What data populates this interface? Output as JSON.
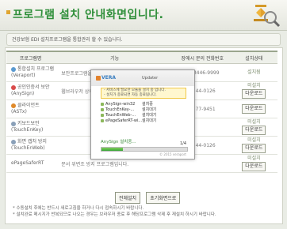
{
  "header": {
    "title": "프로그램 설치 안내화면입니다."
  },
  "notice": "건강보험 EDI 설치프로그램을 통합관리 할 수 있습니다.",
  "table": {
    "headers": [
      "프로그램명",
      "기능",
      "장애시 문의 전화번호",
      "설치상태"
    ],
    "rows": [
      {
        "name": "통합설치 프로그램 (Veraport)",
        "desc": "보안프로그램을 편리하게 다운받기 위한 프로그램입",
        "phone": "02-3446-9999",
        "status": "설치됨",
        "button": ""
      },
      {
        "name": "공인인증서 보안(AnySign)",
        "desc": "웹브라우저 상의 공인인증서",
        "phone": "1544-0126",
        "status": "미설치",
        "button": "다운로드"
      },
      {
        "name": "클라이언트(ASTx)",
        "desc": "",
        "phone": "1577-9451",
        "status": "",
        "button": "다운로드"
      },
      {
        "name": "키보드보안 (TouchEnKey)",
        "desc": "",
        "phone": "",
        "status": "미설치",
        "button": "다운로드"
      },
      {
        "name": "화면 캡처 방지 (TouchEnWeb)",
        "desc": "",
        "phone": "1544-0126",
        "status": "미설치",
        "button": "다운로드"
      },
      {
        "name": "ePageSaferRT",
        "desc": "문서 위변조 방지 프로그램입니다.",
        "phone": "",
        "status": "미설치",
        "button": "다운로드"
      }
    ]
  },
  "buttons": {
    "install_all": "전체설치",
    "back": "초기화면으로"
  },
  "footnotes": [
    "* 수동설치 후에는 반드시 새로고침을 하거나 다시 접속하시기 바랍니다.",
    "* 설치완료 메시지가 반복되므로 나오는 경우는 브라우저 종료 후 해당프로그램 삭제 후 재설치 하시기 바랍니다."
  ],
  "popup": {
    "logo": "VERA",
    "subtitle": "Updater",
    "message_line1": "- 서비스에 필요한 모듈을 설치 중 입니다.",
    "message_line2": "- 설치가 종료되면 자동 종료됩니다.",
    "items": [
      {
        "name": "AnySign-win32",
        "state": "설치중"
      },
      {
        "name": "TouchEnKey-...",
        "state": "설치대기"
      },
      {
        "name": "TouchEnWeb-...",
        "state": "설치대기"
      },
      {
        "name": "ePageSaferRT-wi...",
        "state": "설치대기"
      }
    ],
    "status": "AnySign 설치중...",
    "count": "1/4",
    "progress": 0.25,
    "footer": "© 2015 veraport"
  }
}
